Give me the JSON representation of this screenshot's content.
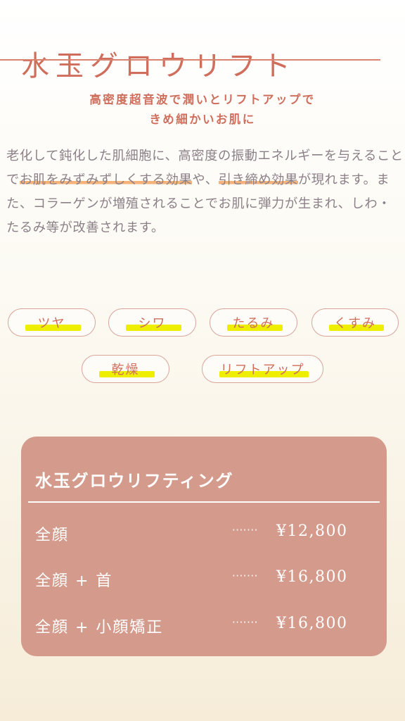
{
  "header": {
    "title": "水玉グロウリフト",
    "subtitle_line1": "高密度超音波で潤いとリフトアップで",
    "subtitle_line2": "きめ細かいお肌に"
  },
  "description": {
    "part1": "老化して鈍化した肌細胞に、高密度の振動エネルギーを与えることで",
    "highlight1": "お肌をみずみずしくする効果",
    "part2": "や、",
    "highlight2": "引き締め効果",
    "part3": "が現れます。また、コラーゲンが増殖されることでお肌に弾力が生まれ、しわ・たるみ等が改善されます。"
  },
  "tags": [
    "ツヤ",
    "シワ",
    "たるみ",
    "くすみ",
    "乾燥",
    "リフトアップ"
  ],
  "price_card": {
    "title": "水玉グロウリフティング",
    "rows": [
      {
        "label": "全顔",
        "dots": "·······",
        "price": "¥12,800"
      },
      {
        "label": "全顔 + 首",
        "dots": "·······",
        "price": "¥16,800"
      },
      {
        "label": "全顔 + 小顔矯正",
        "dots": "·······",
        "price": "¥16,800"
      }
    ]
  },
  "colors": {
    "accent": "#cf6e5c",
    "body_text": "#8c8088",
    "highlight_orange": "#f6b278",
    "highlight_yellow": "#eeef00",
    "card_bg": "#d49a8c"
  }
}
